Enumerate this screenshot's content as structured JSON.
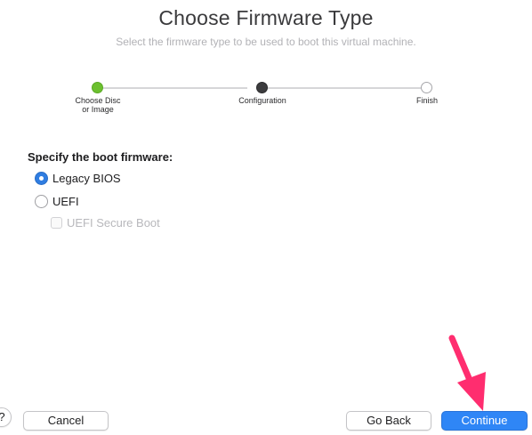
{
  "header": {
    "title": "Choose Firmware Type",
    "subtitle": "Select the firmware type to be used to boot this virtual machine."
  },
  "stepper": {
    "steps": [
      {
        "label_line1": "Choose Disc",
        "label_line2": "or Image",
        "state": "done"
      },
      {
        "label_line1": "Configuration",
        "label_line2": "",
        "state": "current"
      },
      {
        "label_line1": "Finish",
        "label_line2": "",
        "state": "future"
      }
    ]
  },
  "firmware": {
    "section_label": "Specify the boot firmware:",
    "options": [
      {
        "label": "Legacy BIOS",
        "selected": true
      },
      {
        "label": "UEFI",
        "selected": false
      }
    ],
    "secure_boot": {
      "label": "UEFI Secure Boot",
      "checked": false,
      "enabled": false
    }
  },
  "footer": {
    "help_label": "?",
    "cancel_label": "Cancel",
    "back_label": "Go Back",
    "continue_label": "Continue"
  },
  "colors": {
    "accent": "#2f86f6",
    "done_step": "#6cc02f",
    "annotation_arrow": "#ff2d6f"
  }
}
